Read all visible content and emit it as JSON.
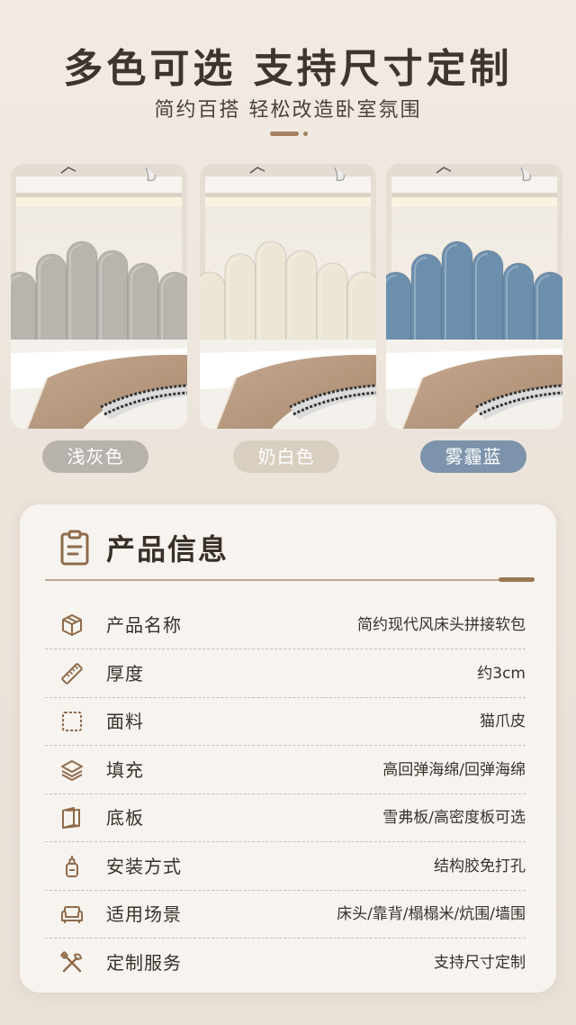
{
  "hero": {
    "title": "多色可选  支持尺寸定制",
    "subtitle": "简约百搭  轻松改造卧室氛围"
  },
  "colors": [
    {
      "label": "浅灰色",
      "panel_color": "#b9b4ae",
      "pill_bg": "#b8b2ac",
      "pill_text": "#ffffff"
    },
    {
      "label": "奶白色",
      "panel_color": "#ede6d5",
      "pill_bg": "#d8cfc1",
      "pill_text": "#ffffff"
    },
    {
      "label": "雾霾蓝",
      "panel_color": "#6d8fae",
      "pill_bg": "#7c93ab",
      "pill_text": "#ffffff"
    }
  ],
  "info": {
    "title": "产品信息",
    "rows": [
      {
        "icon": "box-icon",
        "label": "产品名称",
        "value": "简约现代风床头拼接软包"
      },
      {
        "icon": "ruler-icon",
        "label": "厚度",
        "value": "约3cm"
      },
      {
        "icon": "fabric-icon",
        "label": "面料",
        "value": "猫爪皮"
      },
      {
        "icon": "layers-icon",
        "label": "填充",
        "value": "高回弹海绵/回弹海绵"
      },
      {
        "icon": "board-icon",
        "label": "底板",
        "value": "雪弗板/高密度板可选"
      },
      {
        "icon": "glue-icon",
        "label": "安装方式",
        "value": "结构胶免打孔"
      },
      {
        "icon": "sofa-icon",
        "label": "适用场景",
        "value": "床头/靠背/榻榻米/炕围/墙围"
      },
      {
        "icon": "tools-icon",
        "label": "定制服务",
        "value": "支持尺寸定制"
      }
    ]
  },
  "accent_color": "#9a7653"
}
